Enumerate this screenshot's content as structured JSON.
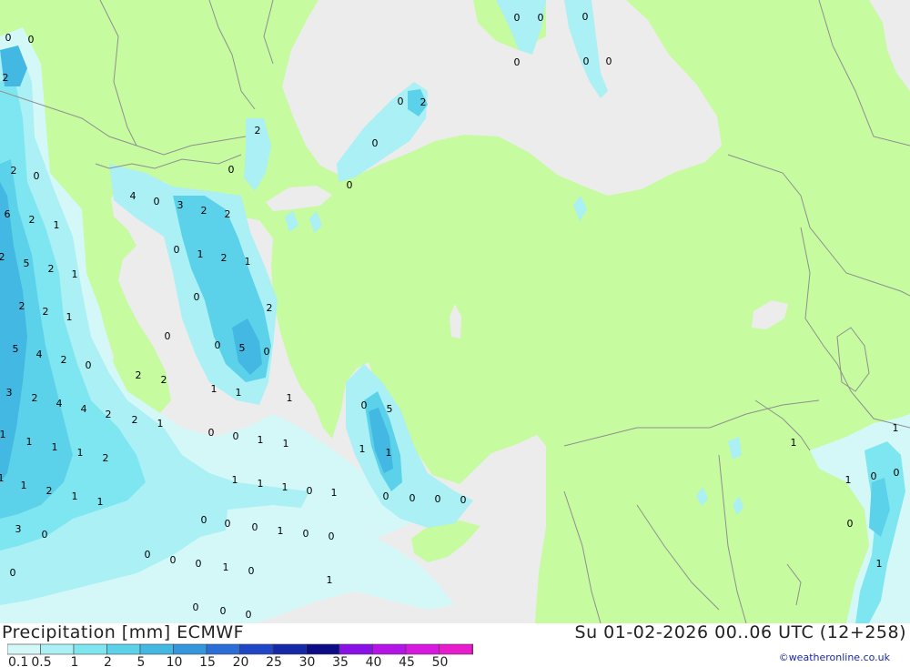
{
  "title": "Precipitation [mm] ECMWF",
  "valid_time": "Su 01-02-2026 00..06 UTC (12+258)",
  "credit": "©weatheronline.co.uk",
  "legend": {
    "labels": [
      "0.1",
      "0.5",
      "1",
      "2",
      "5",
      "10",
      "15",
      "20",
      "25",
      "30",
      "35",
      "40",
      "45",
      "50"
    ],
    "colors": [
      "#d4f8f8",
      "#aaf0f5",
      "#7ee6f0",
      "#5cd2ea",
      "#42b8e2",
      "#3496dd",
      "#2c6ed8",
      "#2046c8",
      "#1428a8",
      "#0c0c88",
      "#8a10e8",
      "#b414e8",
      "#d818e0",
      "#e81ccc",
      "#b40aa0"
    ]
  },
  "colors": {
    "land": "#c6fb9f",
    "sea": "#ececec",
    "border": "#8f8f8f"
  },
  "map_values": [
    "0",
    "0",
    "2",
    "2",
    "0",
    "2",
    "6",
    "2",
    "1",
    "2",
    "5",
    "2",
    "1",
    "2",
    "2",
    "1",
    "5",
    "4",
    "2",
    "0",
    "3",
    "2",
    "4",
    "4",
    "2",
    "2",
    "1",
    "1",
    "1",
    "1",
    "1",
    "2",
    "1",
    "1",
    "2",
    "1",
    "1",
    "3",
    "0",
    "0",
    "4",
    "0",
    "3",
    "2",
    "2",
    "0",
    "1",
    "2",
    "1",
    "0",
    "0",
    "2",
    "0",
    "0",
    "5",
    "0",
    "2",
    "2",
    "1",
    "1",
    "0",
    "0",
    "1",
    "1",
    "1",
    "1",
    "1",
    "0",
    "1",
    "0",
    "0",
    "0",
    "1",
    "0",
    "0",
    "0",
    "0",
    "0",
    "1",
    "0",
    "0",
    "0",
    "0",
    "0",
    "0",
    "0",
    "0",
    "0",
    "0",
    "0",
    "2",
    "0",
    "0",
    "1",
    "1",
    "0",
    "5",
    "1",
    "1",
    "0",
    "0",
    "0",
    "0",
    "1",
    "1",
    "1",
    "0",
    "0",
    "0",
    "1"
  ]
}
